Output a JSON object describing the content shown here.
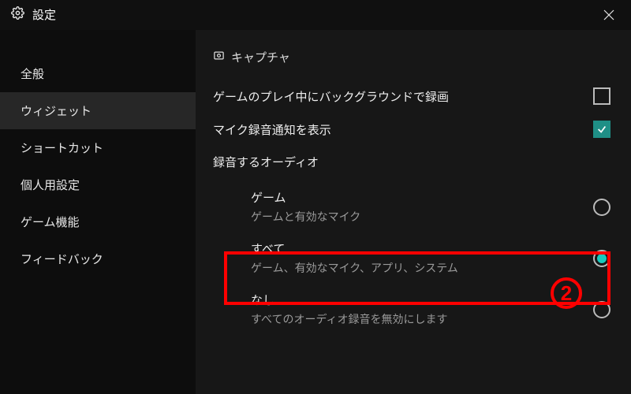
{
  "titlebar": {
    "title": "設定"
  },
  "sidebar": {
    "items": [
      {
        "label": "全般",
        "active": false
      },
      {
        "label": "ウィジェット",
        "active": true
      },
      {
        "label": "ショートカット",
        "active": false
      },
      {
        "label": "個人用設定",
        "active": false
      },
      {
        "label": "ゲーム機能",
        "active": false
      },
      {
        "label": "フィードバック",
        "active": false
      }
    ]
  },
  "content": {
    "section_title": "キャプチャ",
    "bg_record_label": "ゲームのプレイ中にバックグラウンドで録画",
    "bg_record_checked": false,
    "mic_notice_label": "マイク録音通知を表示",
    "mic_notice_checked": true,
    "audio_heading": "録音するオーディオ",
    "radio": [
      {
        "label": "ゲーム",
        "desc": "ゲームと有効なマイク",
        "selected": false
      },
      {
        "label": "すべて",
        "desc": "ゲーム、有効なマイク、アプリ、システム",
        "selected": true
      },
      {
        "label": "なし",
        "desc": "すべてのオーディオ録音を無効にします",
        "selected": false
      }
    ]
  },
  "annotation": {
    "badge": "2"
  }
}
